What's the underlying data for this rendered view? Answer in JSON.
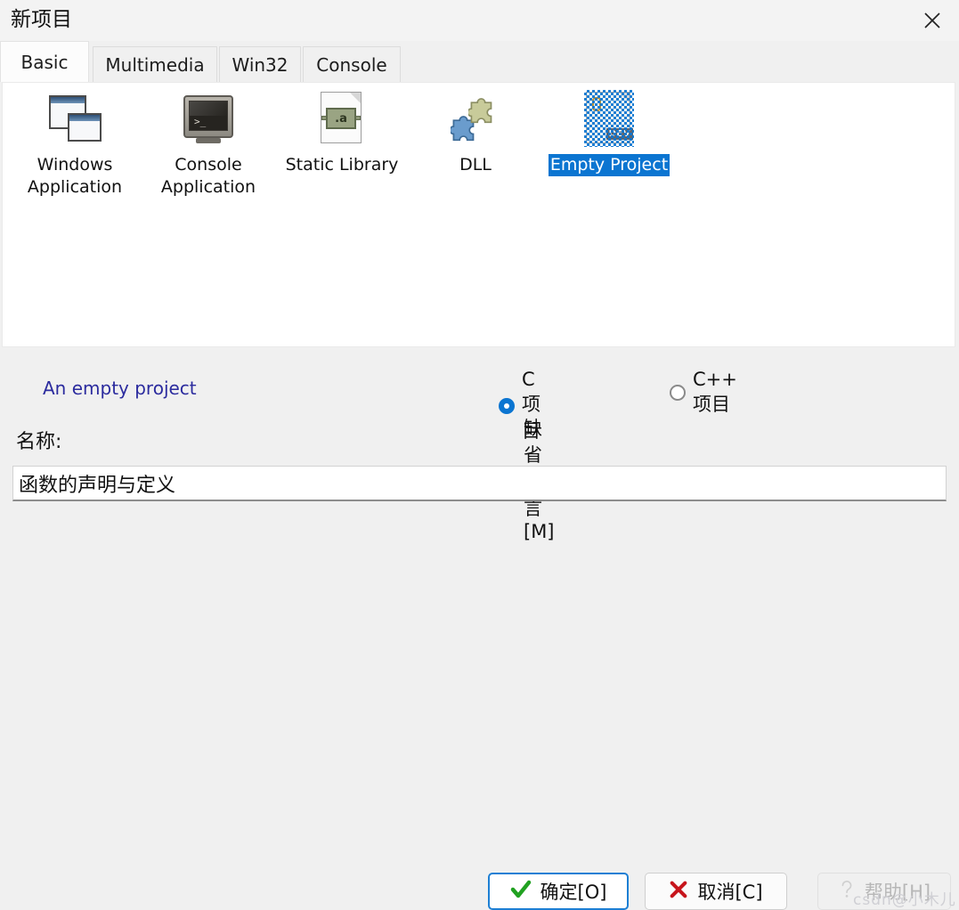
{
  "window": {
    "title": "新项目",
    "close_icon": "close-icon"
  },
  "tabs": [
    {
      "label": "Basic",
      "active": true
    },
    {
      "label": "Multimedia",
      "active": false
    },
    {
      "label": "Win32",
      "active": false
    },
    {
      "label": "Console",
      "active": false
    }
  ],
  "projects": [
    {
      "label": "Windows\nApplication",
      "icon": "windows-application-icon",
      "selected": false
    },
    {
      "label": "Console\nApplication",
      "icon": "console-application-icon",
      "selected": false
    },
    {
      "label": "Static Library",
      "icon": "static-library-icon",
      "selected": false
    },
    {
      "label": "DLL",
      "icon": "dll-icon",
      "selected": false
    },
    {
      "label": "Empty Project",
      "icon": "empty-project-icon",
      "selected": true
    }
  ],
  "description": "An empty project",
  "options": {
    "c_project": {
      "label": "C 项目",
      "selected": true
    },
    "cpp_project": {
      "label": "C++ 项目",
      "selected": false
    },
    "default_language": {
      "label": "缺省语言[M]",
      "checked": false
    }
  },
  "name_field": {
    "label": "名称:",
    "value": "函数的声明与定义",
    "placeholder": ""
  },
  "buttons": {
    "ok": {
      "label": "确定[O]",
      "icon": "checkmark-icon",
      "default": true
    },
    "cancel": {
      "label": "取消[C]",
      "icon": "cross-icon"
    },
    "help": {
      "label": "帮助[H]",
      "icon": "question-mark-icon",
      "disabled": true
    }
  },
  "watermark": "csdn@小木儿",
  "colors": {
    "accent": "#0b75d1",
    "selection": "#0b75d1",
    "description_text": "#2b2b9e",
    "ok_check": "#21a121",
    "cancel_cross": "#c7161d",
    "window_bg": "#f0f0f0",
    "panel_bg": "#ffffff"
  },
  "icon_glyphs": {
    "static_library_chip": ".a",
    "empty_project_tag": "DEV",
    "console_prompt": ">_"
  }
}
